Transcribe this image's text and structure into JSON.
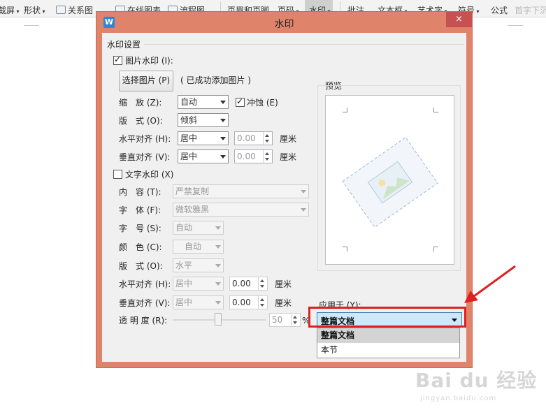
{
  "ribbon": {
    "items": [
      "截屏",
      "形状",
      "关系图",
      "在线图表",
      "流程图",
      "页眉和页脚",
      "页码",
      "水印",
      "批注",
      "文本框",
      "艺术字",
      "符号",
      "公式"
    ],
    "overflow_item": "首字下沉"
  },
  "dialog": {
    "title": "水印",
    "close_glyph": "×",
    "section_title": "水印设置",
    "picture": {
      "checkbox_label": "图片水印 (I):",
      "checked": true,
      "select_button": "选择图片 (P)",
      "status": "( 已成功添加图片 )",
      "scale_label": "缩　放 (Z):",
      "scale_value": "自动",
      "washout_label": "冲蚀 (E)",
      "washout_checked": true,
      "layout_label": "版　式 (O):",
      "layout_value": "倾斜",
      "halign_label": "水平对齐 (H):",
      "halign_value": "居中",
      "halign_offset": "0.00",
      "valign_label": "垂直对齐 (V):",
      "valign_value": "居中",
      "valign_offset": "0.00",
      "unit": "厘米"
    },
    "text": {
      "checkbox_label": "文字水印 (X)",
      "checked": false,
      "content_label": "内　容 (T):",
      "content_value": "严禁复制",
      "font_label": "字　体 (F):",
      "font_value": "微软雅黑",
      "size_label": "字　号 (S):",
      "size_value": "自动",
      "color_label": "颜　色 (C):",
      "color_value": "自动",
      "layout_label": "版　式 (O):",
      "layout_value": "水平",
      "halign_label": "水平对齐 (H):",
      "halign_value": "居中",
      "halign_offset": "0.00",
      "valign_label": "垂直对齐 (V):",
      "valign_value": "居中",
      "valign_offset": "0.00",
      "unit": "厘米",
      "transparency_label": "透 明 度 (R):",
      "transparency_value": "50",
      "transparency_percent": 50,
      "percent_sign": "%"
    },
    "preview_label": "预览",
    "apply": {
      "label": "应用于 (Y):",
      "value": "整篇文档",
      "options": [
        "整篇文档",
        "本节"
      ]
    }
  },
  "watermark": {
    "logo": "Bai du 经验",
    "url": "jingyan.baidu.com"
  },
  "colors": {
    "dialog_frame": "#e0836b",
    "close_button": "#c75050",
    "annotation": "#e02020"
  }
}
